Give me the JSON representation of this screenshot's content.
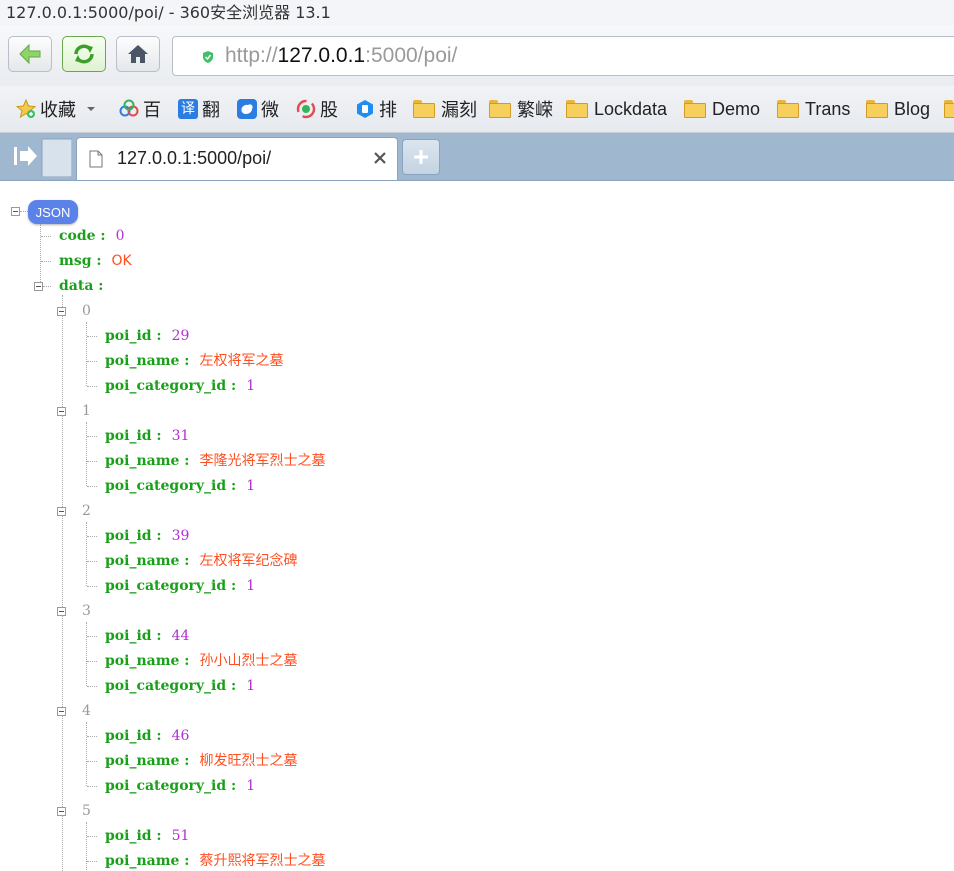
{
  "window": {
    "title": "127.0.0.1:5000/poi/ - 360安全浏览器 13.1"
  },
  "address": {
    "scheme": "http://",
    "host": "127.0.0.1",
    "rest": ":5000/poi/"
  },
  "bookmarks": [
    {
      "label": "收藏",
      "icon": "star-icon"
    },
    {
      "label": "百",
      "icon": "baidu-icon"
    },
    {
      "label": "翻",
      "icon": "translate-icon"
    },
    {
      "label": "微",
      "icon": "weibo-icon"
    },
    {
      "label": "股",
      "icon": "stock-icon"
    },
    {
      "label": "排",
      "icon": "rank-icon"
    },
    {
      "label": "漏刻",
      "icon": "folder-icon"
    },
    {
      "label": "繁嵘",
      "icon": "folder-icon"
    },
    {
      "label": "Lockdata",
      "icon": "folder-icon"
    },
    {
      "label": "Demo",
      "icon": "folder-icon"
    },
    {
      "label": "Trans",
      "icon": "folder-icon"
    },
    {
      "label": "Blog",
      "icon": "folder-icon"
    }
  ],
  "translate_badge": "译",
  "tab": {
    "title": "127.0.0.1:5000/poi/"
  },
  "json": {
    "badge": "JSON",
    "root_keys": {
      "code": "code :",
      "msg": "msg :",
      "data": "data :"
    },
    "code": "0",
    "msg": "OK",
    "item_keys": {
      "poi_id": "poi_id :",
      "poi_name": "poi_name :",
      "poi_category_id": "poi_category_id :"
    },
    "items": [
      {
        "index": "0",
        "poi_id": "29",
        "poi_name": "左权将军之墓",
        "poi_category_id": "1"
      },
      {
        "index": "1",
        "poi_id": "31",
        "poi_name": "李隆光将军烈士之墓",
        "poi_category_id": "1"
      },
      {
        "index": "2",
        "poi_id": "39",
        "poi_name": "左权将军纪念碑",
        "poi_category_id": "1"
      },
      {
        "index": "3",
        "poi_id": "44",
        "poi_name": "孙小山烈士之墓",
        "poi_category_id": "1"
      },
      {
        "index": "4",
        "poi_id": "46",
        "poi_name": "柳发旺烈士之墓",
        "poi_category_id": "1"
      },
      {
        "index": "5",
        "poi_id": "51",
        "poi_name": "蔡升熙将军烈士之墓",
        "poi_category_id": ""
      }
    ]
  }
}
